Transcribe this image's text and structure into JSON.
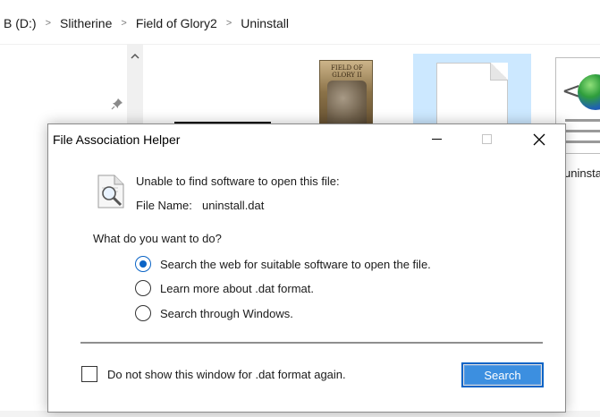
{
  "explorer": {
    "breadcrumbs": [
      "B (D:)",
      "Slitherine",
      "Field of Glory2",
      "Uninstall"
    ],
    "breadcrumb_separator": ">",
    "items": [
      {
        "thumb_text": "FIELD OF GLORY II"
      },
      {
        "label": "uninsta"
      }
    ]
  },
  "dialog": {
    "title": "File Association Helper",
    "message": "Unable to find software to open this file:",
    "file_name_label": "File Name:",
    "file_name_value": "uninstall.dat",
    "question": "What do you want to do?",
    "options": [
      {
        "label": "Search the web for suitable software to open the file.",
        "checked": true
      },
      {
        "label": "Learn more about .dat format.",
        "checked": false
      },
      {
        "label": "Search through Windows.",
        "checked": false
      }
    ],
    "checkbox_label": "Do not show this window for .dat format again.",
    "checkbox_checked": false,
    "search_button": "Search"
  },
  "colors": {
    "accent": "#0a64c6",
    "selection": "#cce8ff"
  }
}
